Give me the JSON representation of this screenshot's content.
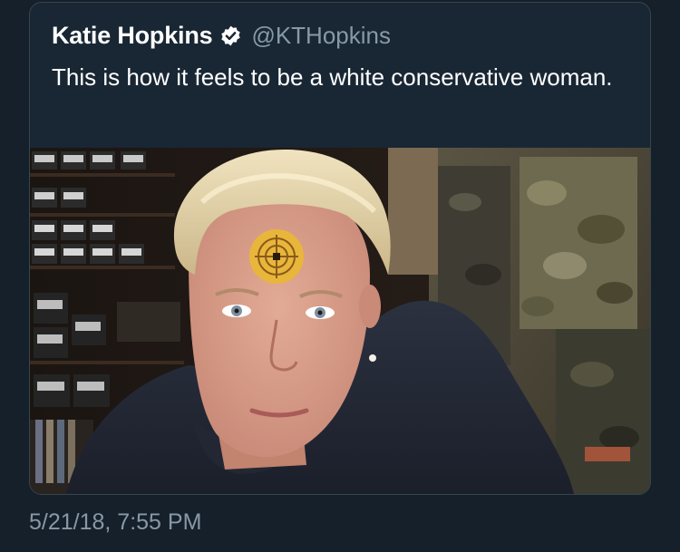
{
  "tweet": {
    "display_name": "Katie Hopkins",
    "verified_icon": "verified-badge-icon",
    "handle": "@KTHopkins",
    "text": "This is how it feels to be a white conservative woman.",
    "timestamp": "5/21/18, 7:55 PM"
  },
  "colors": {
    "background": "#15202b",
    "card": "#192734",
    "text_primary": "#ffffff",
    "text_secondary": "#8899a6",
    "target_sticker": "#e8b63a"
  }
}
